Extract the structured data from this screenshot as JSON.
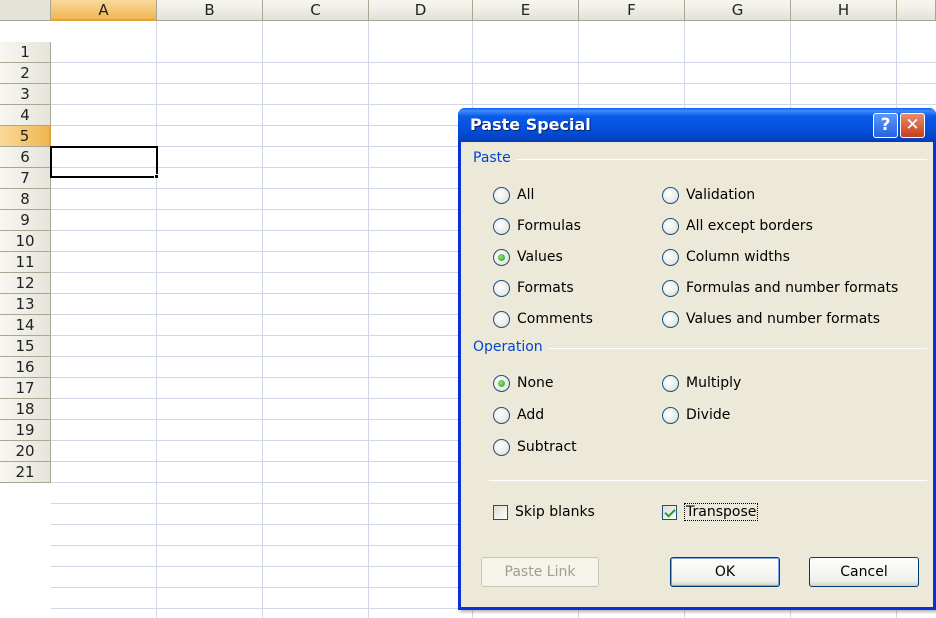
{
  "spreadsheet": {
    "columns": [
      "A",
      "B",
      "C",
      "D",
      "E",
      "F",
      "G",
      "H"
    ],
    "rows": [
      "1",
      "2",
      "3",
      "4",
      "5",
      "6",
      "7",
      "8",
      "9",
      "10",
      "11",
      "12",
      "13",
      "14",
      "15",
      "16",
      "17",
      "18",
      "19",
      "20",
      "21"
    ],
    "selected_column": "A",
    "selected_row": "5"
  },
  "dialog": {
    "title": "Paste Special",
    "help_glyph": "?",
    "close_glyph": "✕",
    "paste_group": {
      "label": "Paste",
      "options": [
        {
          "label": "All",
          "checked": false
        },
        {
          "label": "Formulas",
          "checked": false
        },
        {
          "label": "Values",
          "checked": true
        },
        {
          "label": "Formats",
          "checked": false
        },
        {
          "label": "Comments",
          "checked": false
        },
        {
          "label": "Validation",
          "checked": false
        },
        {
          "label": "All except borders",
          "checked": false
        },
        {
          "label": "Column widths",
          "checked": false
        },
        {
          "label": "Formulas and number formats",
          "checked": false
        },
        {
          "label": "Values and number formats",
          "checked": false
        }
      ]
    },
    "operation_group": {
      "label": "Operation",
      "options": [
        {
          "label": "None",
          "checked": true
        },
        {
          "label": "Add",
          "checked": false
        },
        {
          "label": "Subtract",
          "checked": false
        },
        {
          "label": "Multiply",
          "checked": false
        },
        {
          "label": "Divide",
          "checked": false
        }
      ]
    },
    "checkboxes": {
      "skip_blanks": {
        "label": "Skip blanks",
        "checked": false
      },
      "transpose": {
        "label": "Transpose",
        "checked": true
      }
    },
    "buttons": {
      "paste_link": "Paste Link",
      "ok": "OK",
      "cancel": "Cancel"
    }
  },
  "colors": {
    "titlebar": "#0550dd",
    "group_label": "#0046d5",
    "selection_header": "#f0b752",
    "dialog_bg": "#ece9d8"
  }
}
